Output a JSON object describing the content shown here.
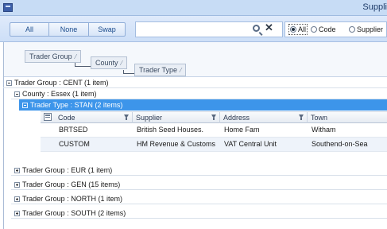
{
  "window": {
    "title": "Suppli"
  },
  "toolbar": {
    "all_label": "All",
    "none_label": "None",
    "swap_label": "Swap",
    "search_value": "",
    "radios": [
      {
        "label": "All",
        "checked": true
      },
      {
        "label": "Code",
        "checked": false
      },
      {
        "label": "Supplier",
        "checked": false
      }
    ]
  },
  "group_panel": {
    "chips": [
      {
        "label": "Trader Group"
      },
      {
        "label": "County"
      },
      {
        "label": "Trader Type"
      }
    ]
  },
  "tree": {
    "group_cent": "Trader Group : CENT (1 item)",
    "county_essex": "County : Essex (1 item)",
    "trader_type_stan": "Trader Type : STAN (2 items)",
    "columns": [
      "Code",
      "Supplier",
      "Address",
      "Town"
    ],
    "rows": [
      {
        "code": "BRTSED",
        "supplier": "British Seed Houses.",
        "address": "Home Fam",
        "town": "Witham"
      },
      {
        "code": "CUSTOM",
        "supplier": "HM Revenue & Customs",
        "address": "VAT Central Unit",
        "town": "Southend-on-Sea"
      }
    ],
    "collapsed_groups": [
      "Trader Group : EUR (1 item)",
      "Trader Group : GEN (15 items)",
      "Trader Group : NORTH (1 item)",
      "Trader Group : SOUTH (2 items)"
    ]
  },
  "colors": {
    "selected_row": "#3d95ea",
    "toolbar_bg": "#cddff7",
    "alt_row": "#eef3fa"
  },
  "icons": [
    "app-icon",
    "search-icon",
    "clear-icon",
    "column-chooser-icon",
    "filter-icon",
    "expand-icon",
    "collapse-icon"
  ]
}
